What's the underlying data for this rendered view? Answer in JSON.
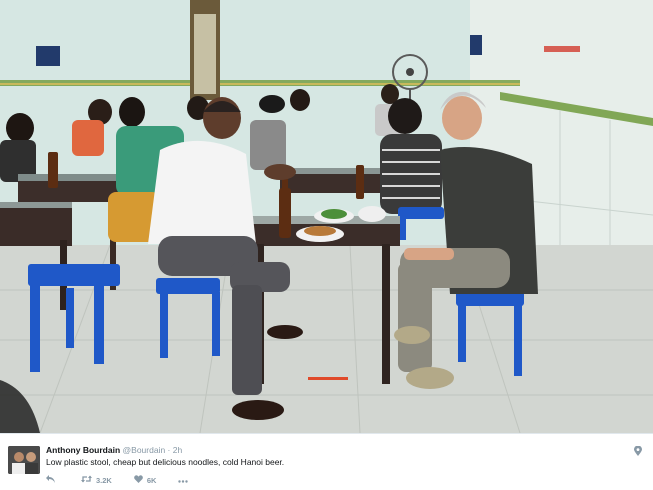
{
  "tweet": {
    "name": "Anthony Bourdain",
    "handle": "@Bourdain",
    "separator": "·",
    "time": "2h",
    "text": "Low plastic stool,  cheap but delicious noodles, cold Hanoi beer.",
    "retweets": "3.2K",
    "likes": "6K"
  },
  "icons": {
    "reply": "reply-icon",
    "retweet": "retweet-icon",
    "like": "heart-icon",
    "more": "more-icon",
    "location": "location-pin-icon"
  },
  "colors": {
    "name": "#14171a",
    "secondary": "#8899a6",
    "stool": "#1f58c8",
    "wall": "#dce9e6",
    "tile_border": "#6f9a3c"
  }
}
